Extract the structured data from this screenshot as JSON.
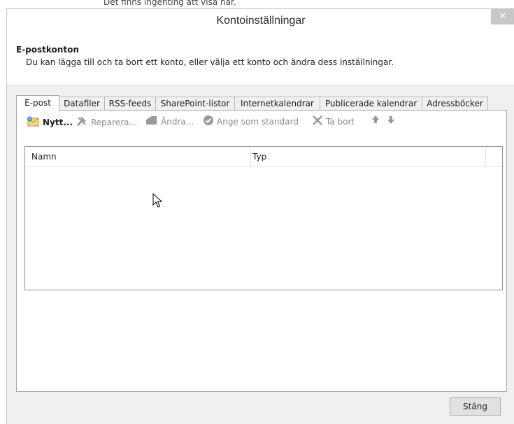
{
  "background": {
    "text": "Det finns ingenting att visa här."
  },
  "window": {
    "title": "Kontoinställningar",
    "close_symbol": "✕"
  },
  "header": {
    "section_title": "E-postkonton",
    "description": "Du kan lägga till och ta bort ett konto, eller välja ett konto och ändra dess inställningar."
  },
  "tabs": [
    {
      "label": "E-post",
      "active": true
    },
    {
      "label": "Datafiler"
    },
    {
      "label": "RSS-feeds"
    },
    {
      "label": "SharePoint-listor"
    },
    {
      "label": "Internetkalendrar"
    },
    {
      "label": "Publicerade kalendrar"
    },
    {
      "label": "Adressböcker"
    }
  ],
  "toolbar": {
    "new_label": "Nytt...",
    "repair_label": "Reparera...",
    "change_label": "Ändra...",
    "default_label": "Ange som standard",
    "remove_label": "Ta bort",
    "up_icon": "arrow-up-icon",
    "down_icon": "arrow-down-icon"
  },
  "list": {
    "columns": [
      {
        "label": "Namn"
      },
      {
        "label": "Typ"
      }
    ],
    "rows": []
  },
  "footer": {
    "close_label": "Stäng"
  },
  "colors": {
    "window_bg": "#f0f0f0",
    "panel_bg": "#ffffff",
    "border": "#a8a8a8",
    "close_button_bg": "#c7c7c7"
  }
}
